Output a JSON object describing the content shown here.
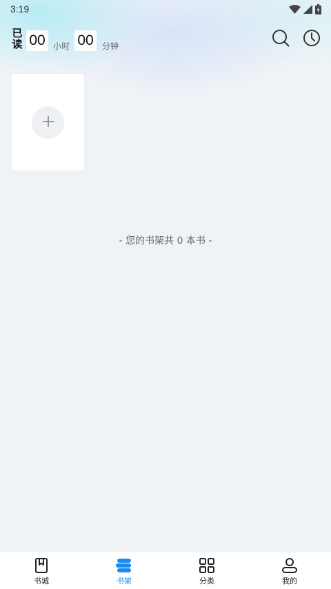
{
  "status_bar": {
    "time": "3:19",
    "icons": [
      "wifi-icon",
      "signal-icon",
      "battery-icon"
    ]
  },
  "header": {
    "read_label": "已读",
    "hours_value": "00",
    "hours_unit": "小时",
    "minutes_value": "00",
    "minutes_unit": "分钟",
    "actions": [
      "search-icon",
      "history-clock-icon"
    ]
  },
  "shelf": {
    "add_icon": "plus-icon",
    "count_text": "- 您的书架共 0 本书 -"
  },
  "bottom_nav": {
    "items": [
      {
        "label": "书城",
        "icon": "bookstore-icon"
      },
      {
        "label": "书架",
        "icon": "bookshelf-icon",
        "active": true
      },
      {
        "label": "分类",
        "icon": "category-grid-icon"
      },
      {
        "label": "我的",
        "icon": "profile-icon"
      }
    ]
  },
  "colors": {
    "accent": "#1a8cf0",
    "background": "#f0f3f6"
  }
}
